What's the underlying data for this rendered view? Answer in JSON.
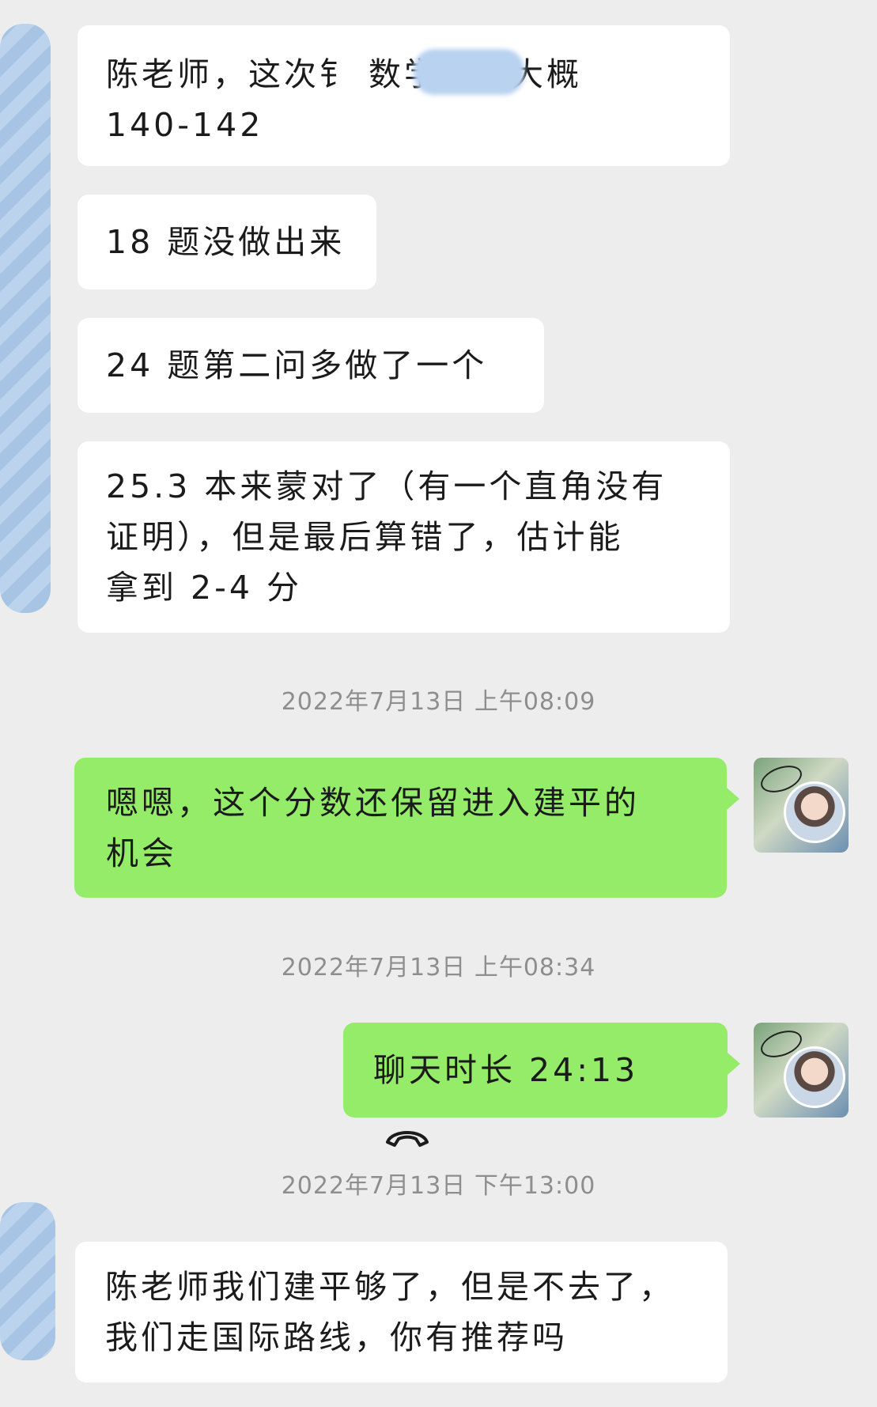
{
  "messages": {
    "m1": "陈老师，这次钅 数学估分大概\n140-142",
    "m2": "18 题没做出来",
    "m3": "24 题第二问多做了一个",
    "m4": "25.3 本来蒙对了（有一个直角没有\n证明），但是最后算错了，估计能\n拿到 2-4 分",
    "m5": "嗯嗯，这个分数还保留进入建平的\n机会",
    "m6_label": "聊天时长 24:13",
    "m7": "陈老师我们建平够了，但是不去了，\n我们走国际路线，你有推荐吗"
  },
  "timestamps": {
    "t1": "2022年7月13日  上午08:09",
    "t2": "2022年7月13日  上午08:34",
    "t3": "2022年7月13日  下午13:00"
  },
  "colors": {
    "background": "#ededed",
    "incoming_bubble": "#ffffff",
    "outgoing_bubble": "#95ec69",
    "timestamp_text": "#8e8e8e"
  },
  "icons": {
    "call": "phone-hangup-icon"
  }
}
